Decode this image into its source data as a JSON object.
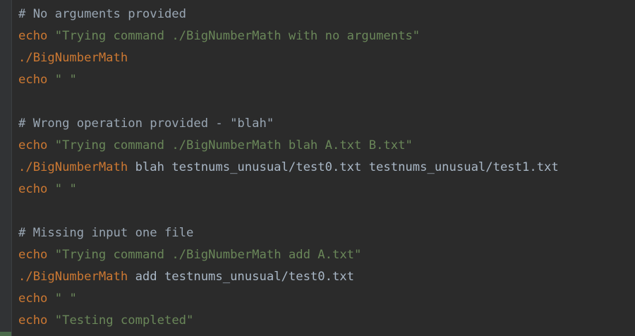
{
  "colors": {
    "background": "#2b2b2b",
    "gutter": "#313335",
    "comment": "#a9b7c6",
    "keyword": "#cc7832",
    "string": "#6a8759",
    "plain": "#a9b7c6"
  },
  "lines": [
    {
      "tokens": [
        {
          "type": "comment",
          "text": "# No arguments provided"
        }
      ]
    },
    {
      "tokens": [
        {
          "type": "keyword",
          "text": "echo"
        },
        {
          "type": "plain",
          "text": " "
        },
        {
          "type": "string",
          "text": "\"Trying command ./BigNumberMath with no arguments\""
        }
      ]
    },
    {
      "tokens": [
        {
          "type": "keyword",
          "text": "./BigNumberMath"
        }
      ]
    },
    {
      "tokens": [
        {
          "type": "keyword",
          "text": "echo"
        },
        {
          "type": "plain",
          "text": " "
        },
        {
          "type": "string",
          "text": "\" \""
        }
      ]
    },
    {
      "tokens": []
    },
    {
      "tokens": [
        {
          "type": "comment",
          "text": "# Wrong operation provided - \"blah\""
        }
      ]
    },
    {
      "tokens": [
        {
          "type": "keyword",
          "text": "echo"
        },
        {
          "type": "plain",
          "text": " "
        },
        {
          "type": "string",
          "text": "\"Trying command ./BigNumberMath blah A.txt B.txt\""
        }
      ]
    },
    {
      "tokens": [
        {
          "type": "keyword",
          "text": "./BigNumberMath"
        },
        {
          "type": "plain",
          "text": " blah testnums_unusual/test0.txt testnums_unusual/test1.txt"
        }
      ]
    },
    {
      "tokens": [
        {
          "type": "keyword",
          "text": "echo"
        },
        {
          "type": "plain",
          "text": " "
        },
        {
          "type": "string",
          "text": "\" \""
        }
      ]
    },
    {
      "tokens": []
    },
    {
      "tokens": [
        {
          "type": "comment",
          "text": "# Missing input one file"
        }
      ]
    },
    {
      "tokens": [
        {
          "type": "keyword",
          "text": "echo"
        },
        {
          "type": "plain",
          "text": " "
        },
        {
          "type": "string",
          "text": "\"Trying command ./BigNumberMath add A.txt\""
        }
      ]
    },
    {
      "tokens": [
        {
          "type": "keyword",
          "text": "./BigNumberMath"
        },
        {
          "type": "plain",
          "text": " add testnums_unusual/test0.txt"
        }
      ]
    },
    {
      "tokens": [
        {
          "type": "keyword",
          "text": "echo"
        },
        {
          "type": "plain",
          "text": " "
        },
        {
          "type": "string",
          "text": "\" \""
        }
      ]
    },
    {
      "tokens": [
        {
          "type": "keyword",
          "text": "echo"
        },
        {
          "type": "plain",
          "text": " "
        },
        {
          "type": "string",
          "text": "\"Testing completed\""
        }
      ]
    }
  ]
}
